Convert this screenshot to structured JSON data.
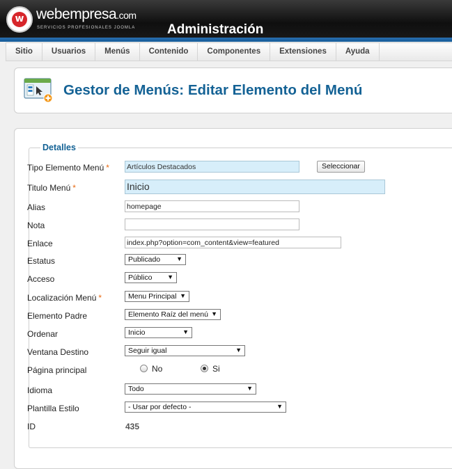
{
  "brand": {
    "name": "webempresa",
    "tld": ".com",
    "tagline": "SERVICIOS PROFESIONALES JOOMLA",
    "mark": "w",
    "admin_title": "Administración"
  },
  "menu": [
    "Sitio",
    "Usuarios",
    "Menús",
    "Contenido",
    "Componentes",
    "Extensiones",
    "Ayuda"
  ],
  "page_title": "Gestor de Menús: Editar Elemento del Menú",
  "form": {
    "legend": "Detalles",
    "tipo": {
      "label": "Tipo Elemento Menú",
      "value": "Artículos Destacados",
      "button": "Seleccionar"
    },
    "titulo": {
      "label": "Titulo Menú",
      "value": "Inicio"
    },
    "alias": {
      "label": "Alias",
      "value": "homepage"
    },
    "nota": {
      "label": "Nota",
      "value": ""
    },
    "enlace": {
      "label": "Enlace",
      "value": "index.php?option=com_content&view=featured"
    },
    "estatus": {
      "label": "Estatus",
      "value": "Publicado"
    },
    "acceso": {
      "label": "Acceso",
      "value": "Público"
    },
    "localizacion": {
      "label": "Localización Menú",
      "value": "Menu Principal"
    },
    "padre": {
      "label": "Elemento Padre",
      "value": "Elemento Raíz del menú"
    },
    "ordenar": {
      "label": "Ordenar",
      "value": "Inicio"
    },
    "ventana": {
      "label": "Ventana Destino",
      "value": "Seguir igual"
    },
    "pagina_principal": {
      "label": "Página principal",
      "options": [
        "No",
        "Si"
      ],
      "selected": "Si"
    },
    "idioma": {
      "label": "Idioma",
      "value": "Todo"
    },
    "plantilla": {
      "label": "Plantilla Estilo",
      "value": "- Usar por defecto -"
    },
    "id": {
      "label": "ID",
      "value": "435"
    },
    "required_mark": "*"
  },
  "colors": {
    "accent": "#146295",
    "required": "#e86a13",
    "highlight": "#d7eefa",
    "header": "#1a1a1a",
    "header_stripe": "#145a97"
  },
  "icons": {
    "logo": "webempresa-logo-icon",
    "menu_manager": "menu-manager-add-icon",
    "dropdown": "chevron-down-icon"
  }
}
